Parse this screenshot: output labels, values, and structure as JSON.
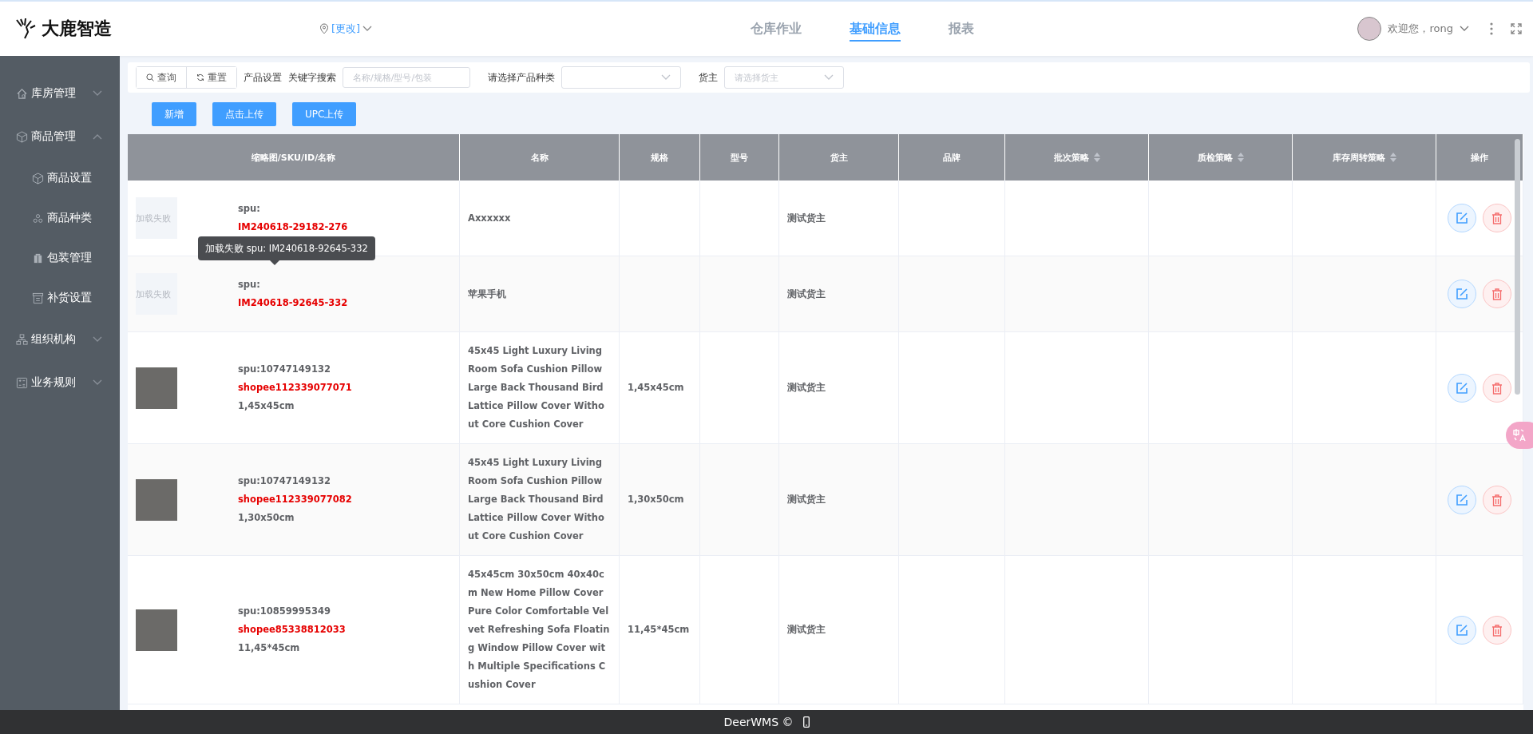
{
  "header": {
    "logo_text": "大鹿智造",
    "location_link": "[更改]",
    "nav_tabs": [
      {
        "label": "仓库作业",
        "selected": false
      },
      {
        "label": "基础信息",
        "selected": true
      },
      {
        "label": "报表",
        "selected": false
      }
    ],
    "user_greeting": "欢迎您，rong"
  },
  "sidebar": {
    "items": [
      {
        "label": "库房管理",
        "expanded": false
      },
      {
        "label": "商品管理",
        "expanded": true,
        "children": [
          {
            "label": "商品设置"
          },
          {
            "label": "商品种类"
          },
          {
            "label": "包装管理"
          },
          {
            "label": "补货设置"
          }
        ]
      },
      {
        "label": "组织机构",
        "expanded": false
      },
      {
        "label": "业务规则",
        "expanded": false
      }
    ]
  },
  "filter_bar": {
    "query_button": "查询",
    "reset_button": "重置",
    "product_settings_label": "产品设置",
    "keyword_label": "关键字搜索",
    "keyword_placeholder": "名称/规格/型号/包装",
    "category_label": "请选择产品种类",
    "owner_label": "货主",
    "owner_placeholder": "请选择货主"
  },
  "action_buttons": [
    "新增",
    "点击上传",
    "UPC上传"
  ],
  "table": {
    "columns": [
      {
        "label": "缩略图/SKU/ID/名称",
        "sortable": false
      },
      {
        "label": "名称",
        "sortable": false
      },
      {
        "label": "规格",
        "sortable": false
      },
      {
        "label": "型号",
        "sortable": false
      },
      {
        "label": "货主",
        "sortable": false
      },
      {
        "label": "品牌",
        "sortable": false
      },
      {
        "label": "批次策略",
        "sortable": true
      },
      {
        "label": "质检策略",
        "sortable": true
      },
      {
        "label": "库存周转策略",
        "sortable": true
      },
      {
        "label": "操作",
        "sortable": false
      }
    ],
    "rows": [
      {
        "thumb": {
          "kind": "failed",
          "text": "加载失败"
        },
        "spu": "spu:",
        "sku": "IM240618-29182-276",
        "name": "Axxxxxx",
        "owner": "测试货主"
      },
      {
        "thumb": {
          "kind": "failed",
          "text": "加载失败"
        },
        "spu": "spu:",
        "sku": "IM240618-92645-332",
        "name": "苹果手机",
        "owner": "测试货主"
      },
      {
        "thumb": {
          "kind": "photo"
        },
        "spu": "spu:10747149132",
        "sku": "shopee112339077071",
        "size": "1,45x45cm",
        "name": "45x45 Light Luxury Living Room Sofa Cushion Pillow Large Back Thousand Bird Lattice Pillow Cover Without Core Cushion Cover",
        "spec": "1,45x45cm",
        "owner": "测试货主"
      },
      {
        "thumb": {
          "kind": "photo"
        },
        "spu": "spu:10747149132",
        "sku": "shopee112339077082",
        "size": "1,30x50cm",
        "name": "45x45 Light Luxury Living Room Sofa Cushion Pillow Large Back Thousand Bird Lattice Pillow Cover Without Core Cushion Cover",
        "spec": "1,30x50cm",
        "owner": "测试货主"
      },
      {
        "thumb": {
          "kind": "photo"
        },
        "spu": "spu:10859995349",
        "sku": "shopee85338812033",
        "size": "11,45*45cm",
        "name": "45x45cm 30x50cm 40x40cm New Home Pillow Cover Pure Color Comfortable Velvet Refreshing Sofa Floating Window Pillow Cover with Multiple Specifications Cushion Cover",
        "spec": "11,45*45cm",
        "owner": "测试货主"
      }
    ],
    "tooltip": "加载失败 spu: IM240618-92645-332"
  },
  "footer": {
    "text": "DeerWMS ©"
  }
}
